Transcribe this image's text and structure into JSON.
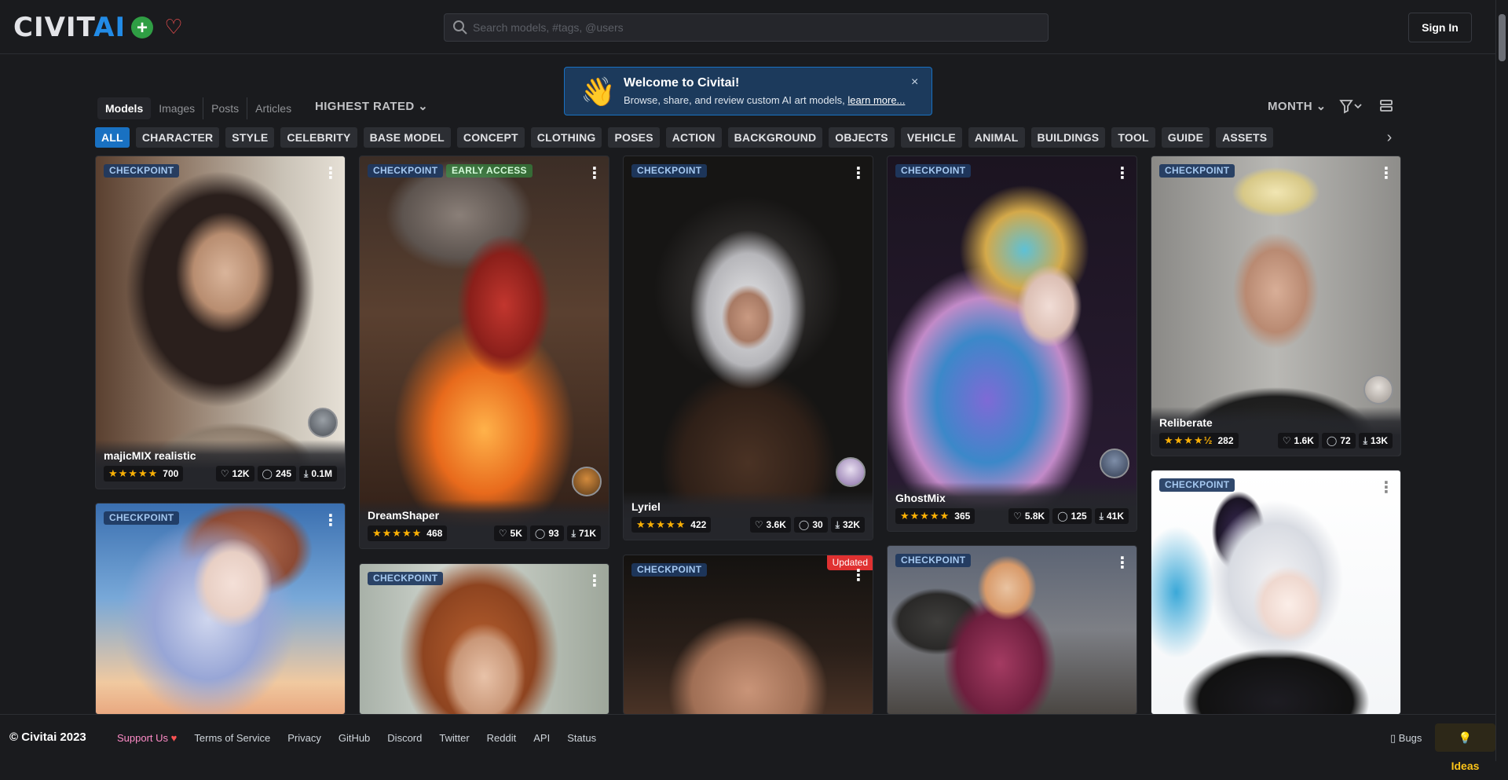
{
  "header": {
    "logo_text": "CIVIT",
    "logo_accent": "AI",
    "create_icon": "plus-circle-icon",
    "favorites_icon": "heart-icon",
    "search_placeholder": "Search models, #tags, @users",
    "sign_in": "Sign In"
  },
  "welcome": {
    "icon": "wave-hand-emoji",
    "title": "Welcome to Civitai!",
    "description": "Browse, share, and review custom AI art models,",
    "link": "learn more...",
    "close": "×"
  },
  "modes": [
    "Models",
    "Images",
    "Posts",
    "Articles"
  ],
  "active_mode": "Models",
  "sort": "HIGHEST RATED",
  "period": "MONTH",
  "categories": [
    "ALL",
    "CHARACTER",
    "STYLE",
    "CELEBRITY",
    "BASE MODEL",
    "CONCEPT",
    "CLOTHING",
    "POSES",
    "ACTION",
    "BACKGROUND",
    "OBJECTS",
    "VEHICLE",
    "ANIMAL",
    "BUILDINGS",
    "TOOL",
    "GUIDE",
    "ASSETS"
  ],
  "active_category": "ALL",
  "cards": [
    {
      "name": "majicMIX realistic",
      "type": "CHECKPOINT",
      "rating": "700",
      "likes": "12K",
      "comments": "245",
      "downloads": "0.1M"
    },
    {
      "name": "DreamShaper",
      "type": "CHECKPOINT",
      "extra_badge": "EARLY ACCESS",
      "rating": "468",
      "likes": "5K",
      "comments": "93",
      "downloads": "71K"
    },
    {
      "name": "Lyriel",
      "type": "CHECKPOINT",
      "rating": "422",
      "likes": "3.6K",
      "comments": "30",
      "downloads": "32K"
    },
    {
      "name": "GhostMix",
      "type": "CHECKPOINT",
      "rating": "365",
      "likes": "5.8K",
      "comments": "125",
      "downloads": "41K"
    },
    {
      "name": "Reliberate",
      "type": "CHECKPOINT",
      "rating": "282",
      "likes": "1.6K",
      "comments": "72",
      "downloads": "13K"
    },
    {
      "type": "CHECKPOINT"
    },
    {
      "type": "CHECKPOINT"
    },
    {
      "type": "CHECKPOINT",
      "status": "Updated"
    },
    {
      "type": "CHECKPOINT"
    },
    {
      "type": "CHECKPOINT"
    }
  ],
  "footer": {
    "copyright": "© Civitai 2023",
    "links": [
      "Support Us",
      "Terms of Service",
      "Privacy",
      "GitHub",
      "Discord",
      "Twitter",
      "Reddit",
      "API",
      "Status"
    ],
    "bugs": "Bugs",
    "ideas": "Ideas"
  },
  "colors": {
    "accent": "#228be6",
    "active_chip": "#1971c2",
    "star": "#fab005",
    "updated": "#e03131",
    "background": "#1a1b1e"
  }
}
